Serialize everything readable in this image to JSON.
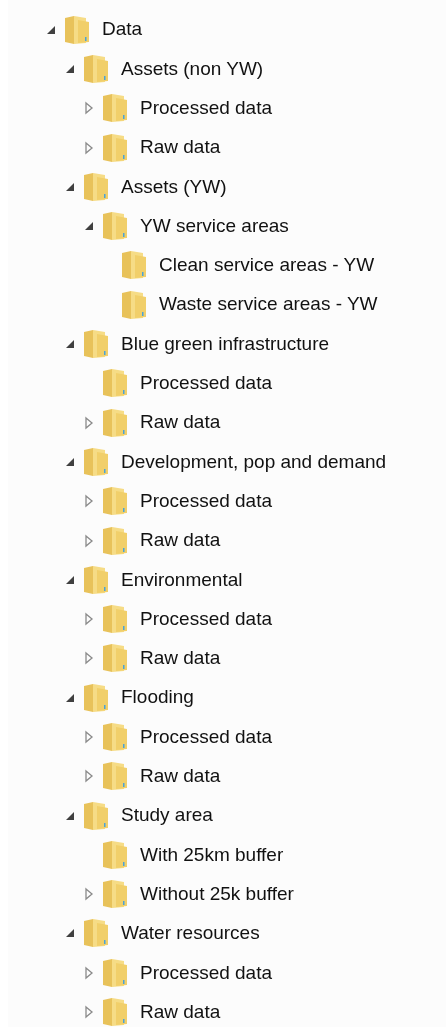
{
  "tree": [
    {
      "label": "Data",
      "expanded": true,
      "children": [
        {
          "label": "Assets (non YW)",
          "expanded": true,
          "children": [
            {
              "label": "Processed data",
              "expanded": false
            },
            {
              "label": "Raw data",
              "expanded": false
            }
          ]
        },
        {
          "label": "Assets (YW)",
          "expanded": true,
          "children": [
            {
              "label": "YW service areas",
              "expanded": true,
              "children": [
                {
                  "label": "Clean service areas - YW"
                },
                {
                  "label": "Waste service areas - YW"
                }
              ]
            }
          ]
        },
        {
          "label": "Blue green infrastructure",
          "expanded": true,
          "children": [
            {
              "label": "Processed data"
            },
            {
              "label": "Raw data",
              "expanded": false
            }
          ]
        },
        {
          "label": "Development, pop and demand",
          "expanded": true,
          "children": [
            {
              "label": "Processed data",
              "expanded": false
            },
            {
              "label": "Raw data",
              "expanded": false
            }
          ]
        },
        {
          "label": "Environmental",
          "expanded": true,
          "children": [
            {
              "label": "Processed data",
              "expanded": false
            },
            {
              "label": "Raw data",
              "expanded": false
            }
          ]
        },
        {
          "label": "Flooding",
          "expanded": true,
          "children": [
            {
              "label": "Processed data",
              "expanded": false
            },
            {
              "label": "Raw data",
              "expanded": false
            }
          ]
        },
        {
          "label": "Study area",
          "expanded": true,
          "children": [
            {
              "label": "With 25km buffer"
            },
            {
              "label": "Without 25k buffer",
              "expanded": false
            }
          ]
        },
        {
          "label": "Water resources",
          "expanded": true,
          "children": [
            {
              "label": "Processed data",
              "expanded": false
            },
            {
              "label": "Raw data",
              "expanded": false
            }
          ]
        }
      ]
    }
  ]
}
